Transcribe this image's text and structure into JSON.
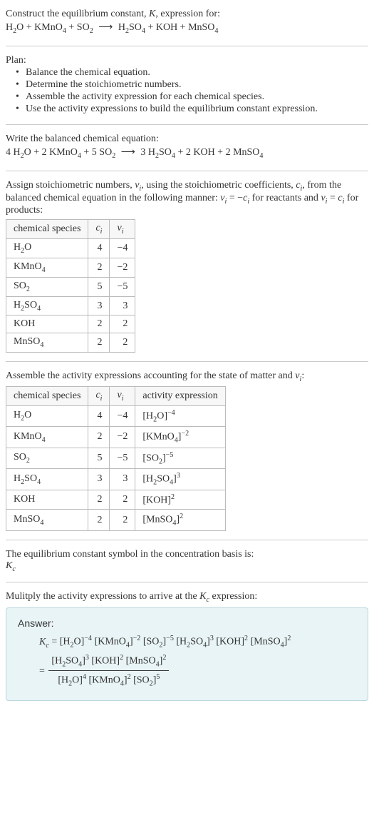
{
  "header": {
    "title_line1": "Construct the equilibrium constant, K, expression for:",
    "equation_raw": "H₂O + KMnO₄ + SO₂ ⟶ H₂SO₄ + KOH + MnSO₄"
  },
  "plan": {
    "label": "Plan:",
    "bullets": [
      "Balance the chemical equation.",
      "Determine the stoichiometric numbers.",
      "Assemble the activity expression for each chemical species.",
      "Use the activity expressions to build the equilibrium constant expression."
    ]
  },
  "balanced": {
    "label": "Write the balanced chemical equation:",
    "equation_raw": "4 H₂O + 2 KMnO₄ + 5 SO₂ ⟶ 3 H₂SO₄ + 2 KOH + 2 MnSO₄"
  },
  "stoich_intro": {
    "pre": "Assign stoichiometric numbers, ",
    "nu": "ν",
    "sub_i": "i",
    "mid1": ", using the stoichiometric coefficients, ",
    "c": "c",
    "mid2": ", from the balanced chemical equation in the following manner: ",
    "eq_react": "νᵢ = −cᵢ",
    "mid3": " for reactants and ",
    "eq_prod": "νᵢ = cᵢ",
    "mid4": " for products:"
  },
  "table1": {
    "headers": {
      "species": "chemical species",
      "c": "cᵢ",
      "nu": "νᵢ"
    },
    "rows": [
      {
        "sp": "H₂O",
        "c": "4",
        "nu": "−4"
      },
      {
        "sp": "KMnO₄",
        "c": "2",
        "nu": "−2"
      },
      {
        "sp": "SO₂",
        "c": "5",
        "nu": "−5"
      },
      {
        "sp": "H₂SO₄",
        "c": "3",
        "nu": "3"
      },
      {
        "sp": "KOH",
        "c": "2",
        "nu": "2"
      },
      {
        "sp": "MnSO₄",
        "c": "2",
        "nu": "2"
      }
    ]
  },
  "activity_intro": "Assemble the activity expressions accounting for the state of matter and νᵢ:",
  "table2": {
    "headers": {
      "species": "chemical species",
      "c": "cᵢ",
      "nu": "νᵢ",
      "act": "activity expression"
    },
    "rows": [
      {
        "sp": "H₂O",
        "c": "4",
        "nu": "−4",
        "act_base": "[H₂O]",
        "act_exp": "−4"
      },
      {
        "sp": "KMnO₄",
        "c": "2",
        "nu": "−2",
        "act_base": "[KMnO₄]",
        "act_exp": "−2"
      },
      {
        "sp": "SO₂",
        "c": "5",
        "nu": "−5",
        "act_base": "[SO₂]",
        "act_exp": "−5"
      },
      {
        "sp": "H₂SO₄",
        "c": "3",
        "nu": "3",
        "act_base": "[H₂SO₄]",
        "act_exp": "3"
      },
      {
        "sp": "KOH",
        "c": "2",
        "nu": "2",
        "act_base": "[KOH]",
        "act_exp": "2"
      },
      {
        "sp": "MnSO₄",
        "c": "2",
        "nu": "2",
        "act_base": "[MnSO₄]",
        "act_exp": "2"
      }
    ]
  },
  "kc_symbol": {
    "line1": "The equilibrium constant symbol in the concentration basis is:",
    "line2_K": "K",
    "line2_c": "c"
  },
  "multiply_intro": "Mulitply the activity expressions to arrive at the Kc expression:",
  "answer": {
    "label": "Answer:",
    "flat": {
      "pre": "Kc = ",
      "terms": [
        {
          "b": "[H₂O]",
          "e": "−4"
        },
        {
          "b": "[KMnO₄]",
          "e": "−2"
        },
        {
          "b": "[SO₂]",
          "e": "−5"
        },
        {
          "b": "[H₂SO₄]",
          "e": "3"
        },
        {
          "b": "[KOH]",
          "e": "2"
        },
        {
          "b": "[MnSO₄]",
          "e": "2"
        }
      ]
    },
    "frac": {
      "eq": "= ",
      "num": [
        {
          "b": "[H₂SO₄]",
          "e": "3"
        },
        {
          "b": "[KOH]",
          "e": "2"
        },
        {
          "b": "[MnSO₄]",
          "e": "2"
        }
      ],
      "den": [
        {
          "b": "[H₂O]",
          "e": "4"
        },
        {
          "b": "[KMnO₄]",
          "e": "2"
        },
        {
          "b": "[SO₂]",
          "e": "5"
        }
      ]
    }
  },
  "chart_data": {
    "type": "table",
    "title": "Stoichiometric numbers and activity expressions",
    "columns": [
      "chemical species",
      "c_i",
      "nu_i",
      "activity expression"
    ],
    "rows": [
      [
        "H2O",
        4,
        -4,
        "[H2O]^-4"
      ],
      [
        "KMnO4",
        2,
        -2,
        "[KMnO4]^-2"
      ],
      [
        "SO2",
        5,
        -5,
        "[SO2]^-5"
      ],
      [
        "H2SO4",
        3,
        3,
        "[H2SO4]^3"
      ],
      [
        "KOH",
        2,
        2,
        "[KOH]^2"
      ],
      [
        "MnSO4",
        2,
        2,
        "[MnSO4]^2"
      ]
    ]
  }
}
